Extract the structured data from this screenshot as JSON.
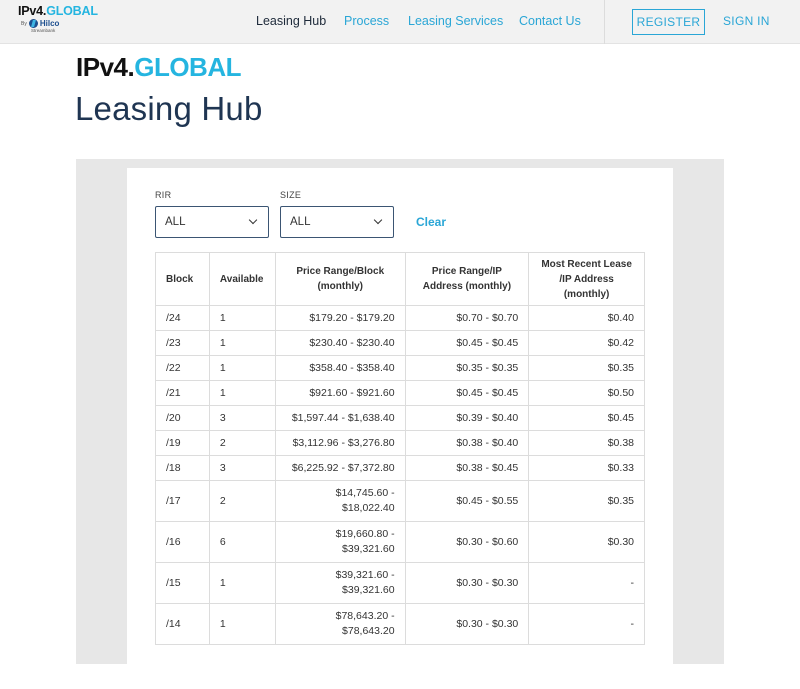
{
  "header": {
    "logo": {
      "main_a": "IPv4.",
      "main_b": "GLOBAL",
      "by": "By",
      "hilco": "Hilco",
      "hilco_sub": "Streambank"
    },
    "nav": [
      {
        "label": "Leasing Hub",
        "active": true
      },
      {
        "label": "Process",
        "active": false
      },
      {
        "label": "Leasing Services",
        "active": false
      },
      {
        "label": "Contact Us",
        "active": false
      }
    ],
    "register_label": "REGISTER",
    "signin_label": "SIGN IN"
  },
  "brand": {
    "part_a": "IPv4.",
    "part_b": "GLOBAL"
  },
  "page_title": "Leasing Hub",
  "filters": {
    "rir": {
      "label": "RIR",
      "value": "ALL"
    },
    "size": {
      "label": "SIZE",
      "value": "ALL"
    },
    "clear_label": "Clear"
  },
  "table": {
    "headers": {
      "block": "Block",
      "available": "Available",
      "price_block": "Price Range/Block (monthly)",
      "price_ip": "Price Range/IP Address (monthly)",
      "recent": "Most Recent Lease /IP Address (monthly)"
    },
    "rows": [
      {
        "block": "/24",
        "available": "1",
        "price_a": "$179.20 - $179.20",
        "price_b": "",
        "ip": "$0.70 - $0.70",
        "recent": "$0.40"
      },
      {
        "block": "/23",
        "available": "1",
        "price_a": "$230.40 - $230.40",
        "price_b": "",
        "ip": "$0.45 - $0.45",
        "recent": "$0.42"
      },
      {
        "block": "/22",
        "available": "1",
        "price_a": "$358.40 - $358.40",
        "price_b": "",
        "ip": "$0.35 - $0.35",
        "recent": "$0.35"
      },
      {
        "block": "/21",
        "available": "1",
        "price_a": "$921.60 - $921.60",
        "price_b": "",
        "ip": "$0.45 - $0.45",
        "recent": "$0.50"
      },
      {
        "block": "/20",
        "available": "3",
        "price_a": "$1,597.44 - $1,638.40",
        "price_b": "",
        "ip": "$0.39 - $0.40",
        "recent": "$0.45"
      },
      {
        "block": "/19",
        "available": "2",
        "price_a": "$3,112.96 - $3,276.80",
        "price_b": "",
        "ip": "$0.38 - $0.40",
        "recent": "$0.38"
      },
      {
        "block": "/18",
        "available": "3",
        "price_a": "$6,225.92 - $7,372.80",
        "price_b": "",
        "ip": "$0.38 - $0.45",
        "recent": "$0.33"
      },
      {
        "block": "/17",
        "available": "2",
        "price_a": "$14,745.60 -",
        "price_b": "$18,022.40",
        "ip": "$0.45 - $0.55",
        "recent": "$0.35"
      },
      {
        "block": "/16",
        "available": "6",
        "price_a": "$19,660.80 -",
        "price_b": "$39,321.60",
        "ip": "$0.30 - $0.60",
        "recent": "$0.30"
      },
      {
        "block": "/15",
        "available": "1",
        "price_a": "$39,321.60 -",
        "price_b": "$39,321.60",
        "ip": "$0.30 - $0.30",
        "recent": "-"
      },
      {
        "block": "/14",
        "available": "1",
        "price_a": "$78,643.20 -",
        "price_b": "$78,643.20",
        "ip": "$0.30 - $0.30",
        "recent": "-"
      }
    ]
  },
  "colors": {
    "accent": "#2aa6d6",
    "title": "#1f3552",
    "panel": "#e7e7e7"
  }
}
